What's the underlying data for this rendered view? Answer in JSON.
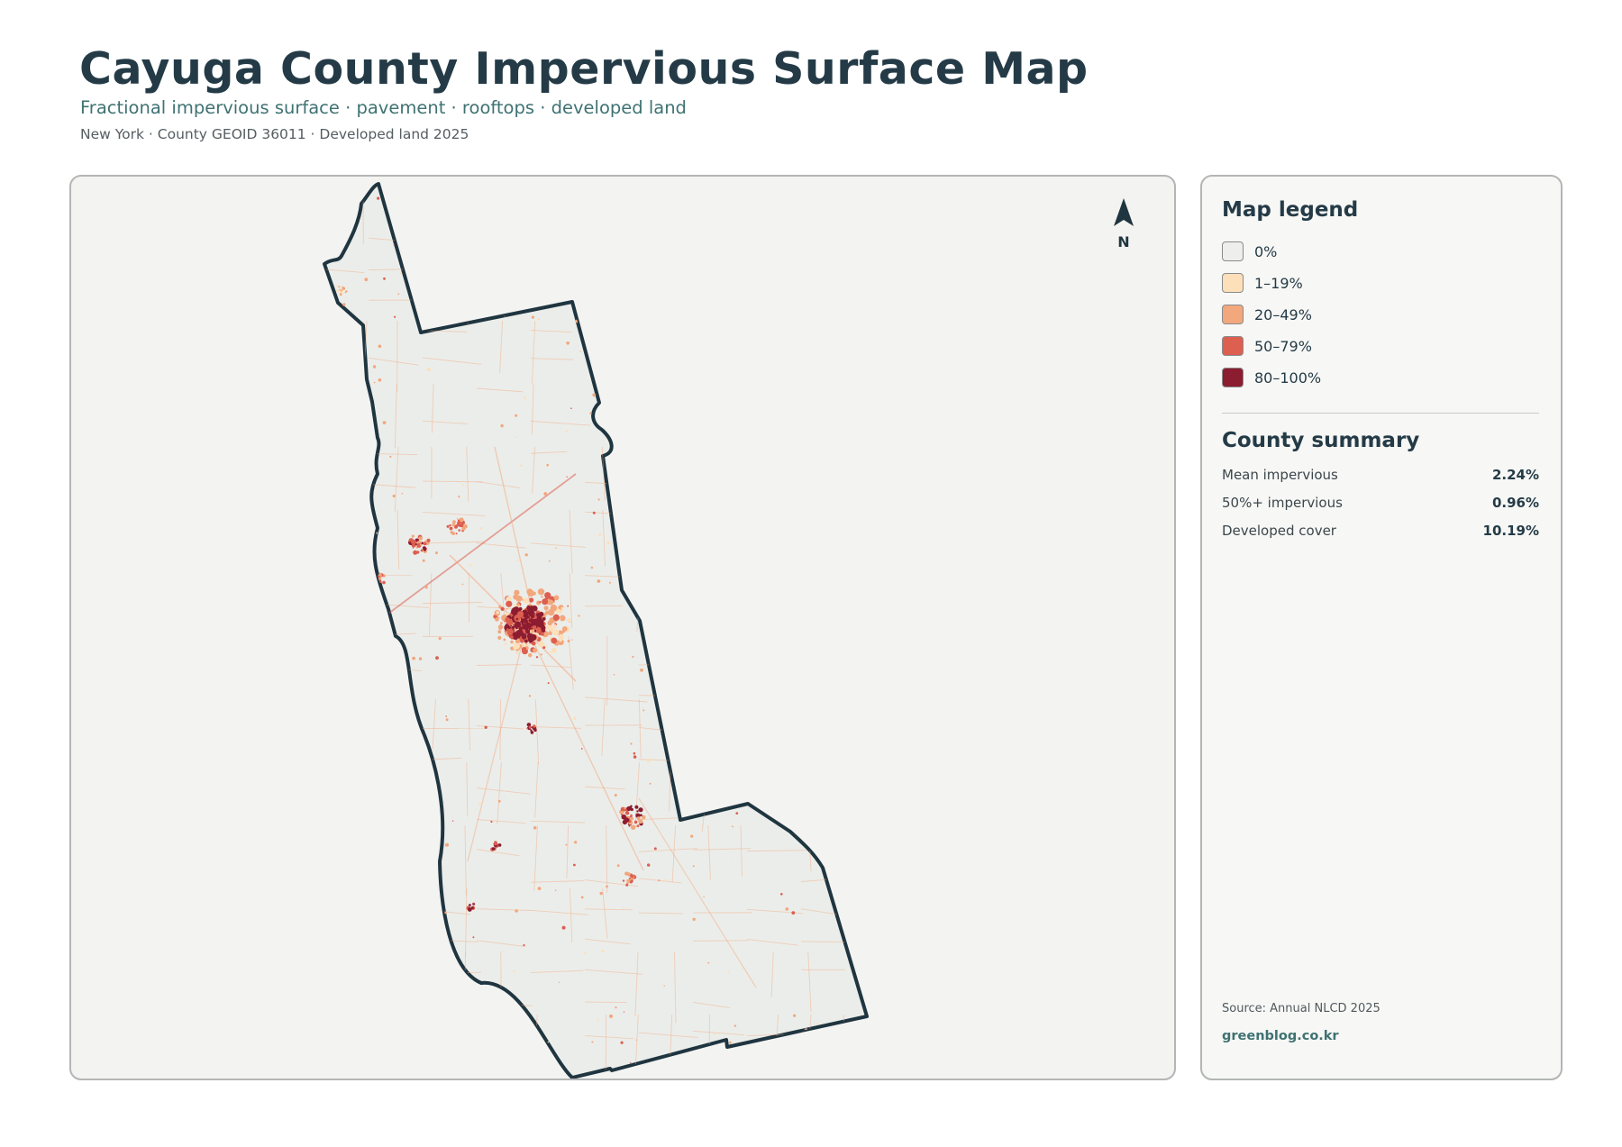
{
  "header": {
    "title": "Cayuga County Impervious Surface Map",
    "subtitle": "Fractional impervious surface · pavement · rooftops · developed land",
    "meta": "New York · County GEOID 36011 · Developed land 2025"
  },
  "map": {
    "north_label": "N",
    "colors": {
      "background": "#f3f3f1",
      "county_fill": "#ebedea",
      "boundary": "#1f3540"
    }
  },
  "legend": {
    "title": "Map legend",
    "items": [
      {
        "label": "0%",
        "color": "#eeeeec"
      },
      {
        "label": "1–19%",
        "color": "#fddfba"
      },
      {
        "label": "20–49%",
        "color": "#f2a77d"
      },
      {
        "label": "50–79%",
        "color": "#dc5f50"
      },
      {
        "label": "80–100%",
        "color": "#8c1c30"
      }
    ]
  },
  "summary": {
    "title": "County summary",
    "stats": [
      {
        "label": "Mean impervious",
        "value": "2.24%"
      },
      {
        "label": "50%+ impervious",
        "value": "0.96%"
      },
      {
        "label": "Developed cover",
        "value": "10.19%"
      }
    ]
  },
  "footer": {
    "source": "Source: Annual NLCD 2025",
    "site": "greenblog.co.kr"
  }
}
